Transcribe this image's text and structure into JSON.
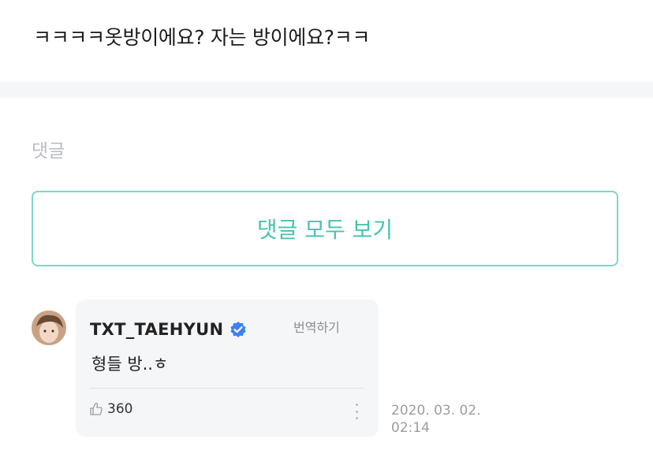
{
  "post": {
    "text": "ㅋㅋㅋㅋ옷방이에요? 자는 방이에요?ㅋㅋ"
  },
  "comments": {
    "heading": "댓글",
    "view_all_label": "댓글 모두 보기",
    "items": [
      {
        "author": "TXT_TAEHYUN",
        "verified": true,
        "translate_label": "번역하기",
        "body": "형들 방..ㅎ",
        "likes": "360",
        "date": "2020. 03. 02.",
        "time": "02:14"
      }
    ]
  },
  "colors": {
    "accent": "#45c4b0",
    "verified_badge": "#3b82f6",
    "bubble_bg": "#f5f6f8"
  },
  "icons": [
    "verified-badge-icon",
    "thumbs-up-icon",
    "more-vertical-icon"
  ]
}
